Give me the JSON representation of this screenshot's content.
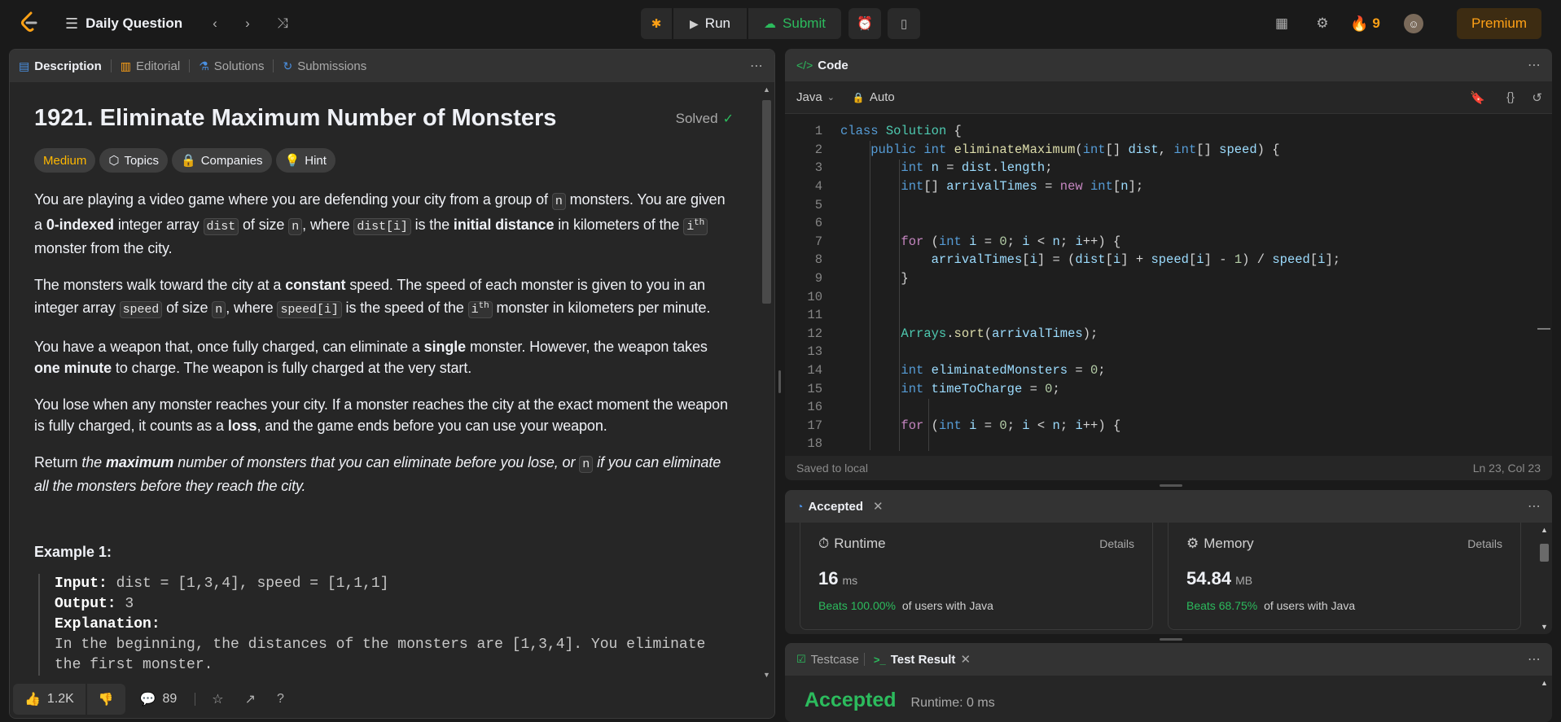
{
  "topbar": {
    "title": "Daily Question",
    "run_label": "Run",
    "submit_label": "Submit",
    "streak_count": "9",
    "premium_label": "Premium"
  },
  "description_panel": {
    "tabs": [
      {
        "label": "Description"
      },
      {
        "label": "Editorial"
      },
      {
        "label": "Solutions"
      },
      {
        "label": "Submissions"
      }
    ],
    "problem_title": "1921. Eliminate Maximum Number of Monsters",
    "solved_label": "Solved",
    "difficulty": "Medium",
    "topics_label": "Topics",
    "companies_label": "Companies",
    "hint_label": "Hint",
    "p1": {
      "a": "You are playing a video game where you are defending your city from a group of ",
      "n1": "n",
      "b": " monsters. You are given a ",
      "bold1": "0-indexed",
      "c": " integer array ",
      "dist": "dist",
      "d": " of size ",
      "n2": "n",
      "e": ", where ",
      "disti": "dist[i]",
      "f": " is the ",
      "bold2": "initial distance",
      "g": " in kilometers of the ",
      "ith_base": "i",
      "ith_sup": "th",
      "h": " monster from the city."
    },
    "p2": {
      "a": "The monsters walk toward the city at a ",
      "bold1": "constant",
      "b": " speed. The speed of each monster is given to you in an integer array ",
      "speed": "speed",
      "c": " of size ",
      "n1": "n",
      "d": ", where ",
      "speedi": "speed[i]",
      "e": " is the speed of the ",
      "ith_base": "i",
      "ith_sup": "th",
      "f": " monster in kilometers per minute."
    },
    "p3": {
      "a": "You have a weapon that, once fully charged, can eliminate a ",
      "bold1": "single",
      "b": " monster. However, the weapon takes ",
      "bold2": "one minute",
      "c": " to charge. The weapon is fully charged at the very start."
    },
    "p4": {
      "a": "You lose when any monster reaches your city. If a monster reaches the city at the exact moment the weapon is fully charged, it counts as a ",
      "bold1": "loss",
      "b": ", and the game ends before you can use your weapon."
    },
    "p5": {
      "a": "Return ",
      "i1": "the ",
      "bi": "maximum",
      "i2": " number of monsters that you can eliminate before you lose, or ",
      "n1": "n",
      "i3": " if you can eliminate all the monsters before they reach the city."
    },
    "example_title": "Example 1:",
    "example": {
      "input_label": "Input:",
      "input_value": " dist = [1,3,4], speed = [1,1,1]",
      "output_label": "Output:",
      "output_value": " 3",
      "explanation_label": "Explanation:",
      "explanation_text": "In the beginning, the distances of the monsters are [1,3,4]. You eliminate the first monster."
    },
    "footer": {
      "likes": "1.2K",
      "comments": "89"
    }
  },
  "code_panel": {
    "title": "Code",
    "language": "Java",
    "mode": "Auto",
    "status_left": "Saved to local",
    "status_right": "Ln 23, Col 23",
    "line_numbers": [
      "1",
      "2",
      "3",
      "4",
      "5",
      "6",
      "7",
      "8",
      "9",
      "10",
      "11",
      "12",
      "13",
      "14",
      "15",
      "16",
      "17",
      "18"
    ]
  },
  "result_panel": {
    "title": "Accepted",
    "runtime": {
      "label": "Runtime",
      "details": "Details",
      "value": "16",
      "unit": "ms",
      "beats": "Beats 100.00%",
      "suffix": "of users with Java"
    },
    "memory": {
      "label": "Memory",
      "details": "Details",
      "value": "54.84",
      "unit": "MB",
      "beats": "Beats 68.75%",
      "suffix": "of users with Java"
    }
  },
  "testcase_panel": {
    "tab_testcase": "Testcase",
    "tab_result": "Test Result",
    "status": "Accepted",
    "runtime_text": "Runtime: 0 ms"
  },
  "colors": {
    "accent_orange": "#ffa116",
    "accent_green": "#2cbb5d",
    "difficulty_medium": "#ffb800",
    "premium_bg": "#3d2c12"
  }
}
